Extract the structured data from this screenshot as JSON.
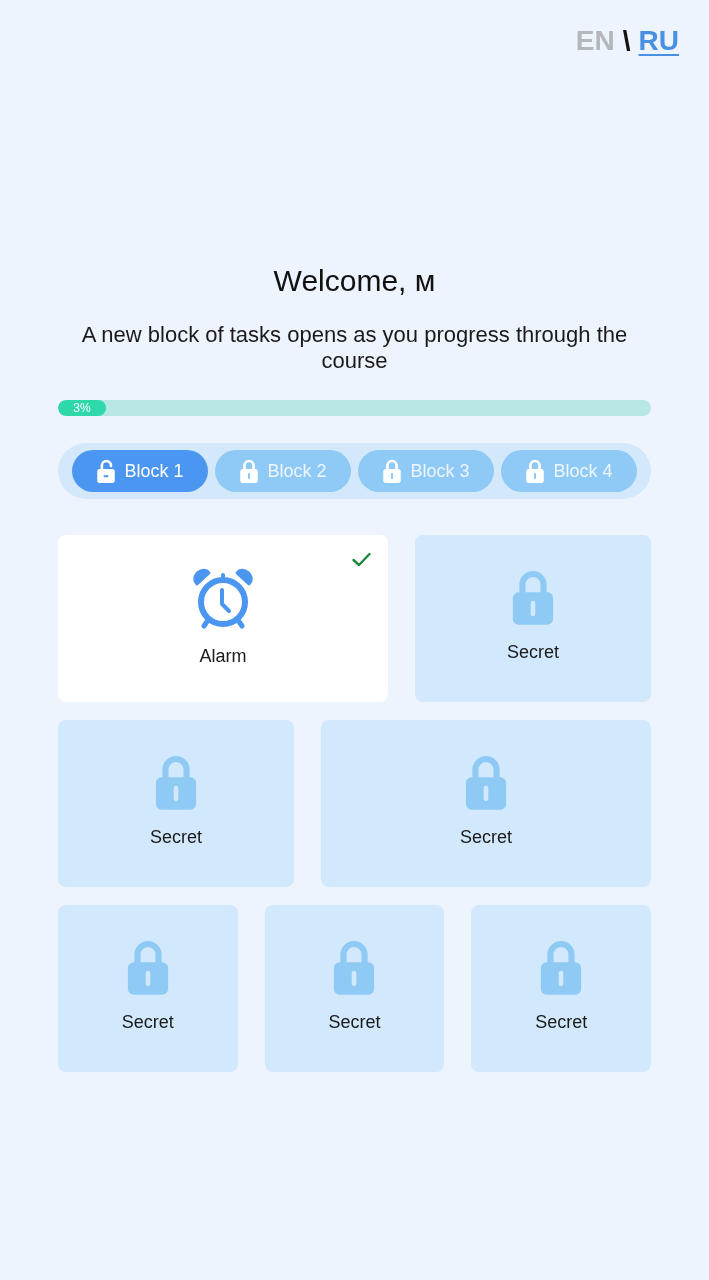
{
  "language_switch": {
    "languages": [
      {
        "label": "EN",
        "selected": false
      },
      {
        "label": "RU",
        "selected": true
      }
    ],
    "separator": "\\"
  },
  "title": "Welcome, м",
  "subtitle": "A new block of tasks opens as you progress through the course",
  "progress": {
    "level": 0.03,
    "label": "3%"
  },
  "tabs": [
    {
      "label": "Block 1",
      "selected": true,
      "locked": false
    },
    {
      "label": "Block 2",
      "selected": false,
      "locked": true
    },
    {
      "label": "Block 3",
      "selected": false,
      "locked": true
    },
    {
      "label": "Block 4",
      "selected": false,
      "locked": true
    }
  ],
  "cards": [
    [
      {
        "label": "Alarm",
        "locked": false,
        "done": true
      },
      {
        "label": "Secret",
        "locked": true,
        "done": false
      }
    ],
    [
      {
        "label": "Secret",
        "locked": true,
        "done": false
      },
      {
        "label": "Secret",
        "locked": true,
        "done": false
      }
    ],
    [
      {
        "label": "Secret",
        "locked": true,
        "done": false
      },
      {
        "label": "Secret",
        "locked": true,
        "done": false
      },
      {
        "label": "Secret",
        "locked": true,
        "done": false
      }
    ]
  ]
}
